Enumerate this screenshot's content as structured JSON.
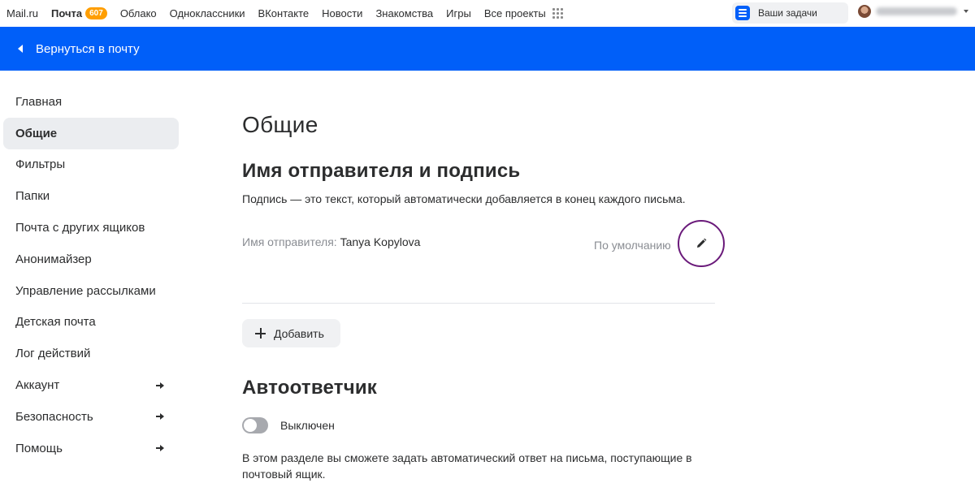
{
  "topbar": {
    "links": [
      {
        "label": "Mail.ru"
      },
      {
        "label": "Почта",
        "badge": "607"
      },
      {
        "label": "Облако"
      },
      {
        "label": "Одноклассники"
      },
      {
        "label": "ВКонтакте"
      },
      {
        "label": "Новости"
      },
      {
        "label": "Знакомства"
      },
      {
        "label": "Игры"
      },
      {
        "label": "Все проекты"
      }
    ],
    "tasks_label": "Ваши задачи"
  },
  "header": {
    "back_label": "Вернуться в почту"
  },
  "sidebar": {
    "items": [
      {
        "label": "Главная"
      },
      {
        "label": "Общие"
      },
      {
        "label": "Фильтры"
      },
      {
        "label": "Папки"
      },
      {
        "label": "Почта с других ящиков"
      },
      {
        "label": "Анонимайзер"
      },
      {
        "label": "Управление рассылками"
      },
      {
        "label": "Детская почта"
      },
      {
        "label": "Лог действий"
      },
      {
        "label": "Аккаунт"
      },
      {
        "label": "Безопасность"
      },
      {
        "label": "Помощь"
      }
    ],
    "active": "Общие"
  },
  "main": {
    "title": "Общие",
    "signature": {
      "title": "Имя отправителя и подпись",
      "description": "Подпись — это текст, который автоматически добавляется в конец каждого письма.",
      "sender_label": "Имя отправителя:",
      "sender_name": "Tanya Kopylova",
      "default_label": "По умолчанию",
      "add_label": "Добавить"
    },
    "autoreply": {
      "title": "Автоответчик",
      "toggle_label": "Выключен",
      "toggle_on": false,
      "description": "В этом разделе вы сможете задать автоматический ответ на письма, поступающие в почтовый ящик."
    }
  },
  "colors": {
    "brand_blue": "#005ff9",
    "badge_orange": "#ff9e00",
    "highlight_ring": "#6a1a7a"
  }
}
